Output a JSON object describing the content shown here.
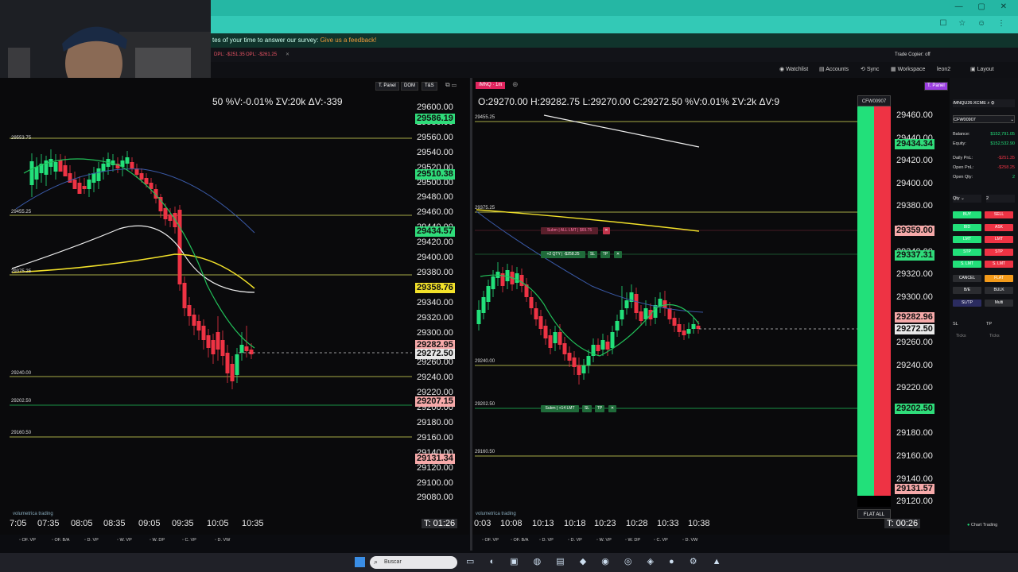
{
  "survey": {
    "text": "tes of your time to answer our survey:",
    "link": "Give us a feedback!"
  },
  "app_top": {
    "dpl": "DPL: -$251.35",
    "opl": "OPL: -$261.25",
    "trade_copier": "Trade Copier: off"
  },
  "nav": {
    "watchlist": "Watchlist",
    "accounts": "Accounts",
    "sync": "Sync",
    "workspace": "Workspace",
    "user": "leon2",
    "layout": "Layout"
  },
  "left_chart": {
    "buttons": {
      "tpanel": "T. Panel",
      "dom": "DOM",
      "ts": "T&S"
    },
    "header": "50 %V:-0.01% ΣV:20k ΔV:-339",
    "axis_ticks": [
      "29600.00",
      "29580.00",
      "29560.00",
      "29540.00",
      "29520.00",
      "29500.00",
      "29480.00",
      "29460.00",
      "29440.00",
      "29420.00",
      "29400.00",
      "29380.00",
      "29360.00",
      "29340.00",
      "29320.00",
      "29300.00",
      "29280.00",
      "29260.00",
      "29240.00",
      "29220.00",
      "29200.00",
      "29180.00",
      "29160.00",
      "29140.00",
      "29120.00",
      "29100.00",
      "29080.00"
    ],
    "labels": {
      "p1": "29586.19",
      "p2": "29510.38",
      "p3": "29434.57",
      "p4": "29358.76",
      "p5": "29282.95",
      "p6": "29272.50",
      "p7": "29207.15",
      "p8": "29131.34"
    },
    "levels": {
      "l1": "29553.75",
      "l2": "29455.25",
      "l3": "29375.25",
      "l4": "29240.00",
      "l5": "29202.50",
      "l6": "29160.50"
    },
    "times": [
      "7:05",
      "07:35",
      "08:05",
      "08:35",
      "09:05",
      "09:35",
      "10:05",
      "10:35"
    ],
    "timer": "T: 01:26",
    "brand": "volumetrica trading",
    "indicators": [
      "OF. VP",
      "OF. B/A",
      "D. VP",
      "W. VP",
      "W. DP",
      "C. VP",
      "D. VW"
    ]
  },
  "right_chart": {
    "symbol": "/MNQ",
    "timeframe": "1m",
    "buttons": {
      "tpanel": "T. Panel",
      "dom": "DOM",
      "ts": "T&S"
    },
    "header": "O:29270.00 H:29282.75 L:29270.00 C:29272.50 %V:0.01% ΣV:2k ΔV:9",
    "axis_ticks": [
      "29460.00",
      "29440.00",
      "29420.00",
      "29400.00",
      "29380.00",
      "29360.00",
      "29340.00",
      "29320.00",
      "29300.00",
      "29280.00",
      "29260.00",
      "29240.00",
      "29220.00",
      "29200.00",
      "29180.00",
      "29160.00",
      "29140.00",
      "29120.00"
    ],
    "labels": {
      "p1": "29434.34",
      "p2": "29359.00",
      "p3": "29337.31",
      "p4": "29282.96",
      "p5": "29272.50",
      "p6": "29202.50",
      "p7": "29131.57"
    },
    "levels": {
      "l1": "29455.25",
      "l2": "29375.25",
      "l3": "29240.00",
      "l4": "29202.50",
      "l5": "29160.50"
    },
    "orders": {
      "o1": "Subm | ALL LMT | $69.75",
      "o2": "+2 QTY | -$258.25",
      "o3": "Subm | +14 LMT"
    },
    "times": [
      "0:03",
      "10:08",
      "10:13",
      "10:18",
      "10:23",
      "10:28",
      "10:33",
      "10:38"
    ],
    "timer": "T: 00:26",
    "account": "CFW00907",
    "flat_all": "FLAT ALL",
    "brand": "volumetrica trading",
    "indicators": [
      "OF. VP",
      "OF. B/A",
      "D. VP",
      "D. VP",
      "W. VP",
      "W. DP",
      "C. VP",
      "D. VW"
    ]
  },
  "trade_panel": {
    "symbol": "/MNQU26:XCME",
    "account": "CFW00907",
    "balance_label": "Balance:",
    "balance": "$152,791.05",
    "equity_label": "Equity:",
    "equity": "$152,532.90",
    "daily_pnl_label": "Daily PnL:",
    "daily_pnl": "-$251.35",
    "open_pnl_label": "Open PnL:",
    "open_pnl": "-$258.25",
    "open_qty_label": "Open Qty:",
    "open_qty": "2",
    "qty_label": "Qty",
    "qty_value": "2",
    "buttons": [
      "BUY",
      "SELL",
      "BID",
      "ASK",
      "LMT",
      "LMT",
      "STP",
      "STP",
      "S. LMT",
      "S. LMT",
      "CANCEL",
      "FLAT",
      "B/E",
      "BULK",
      "SL/TP",
      "Multi"
    ],
    "sl": "SL",
    "tp": "TP",
    "ticks": "Ticks",
    "footer": "Chart Trading"
  },
  "taskbar": {
    "search": "Buscar"
  },
  "colors": {
    "green": "#22e07a",
    "red": "#ee3344",
    "teal": "#2fc3b0",
    "yellow": "#f2e12a"
  }
}
